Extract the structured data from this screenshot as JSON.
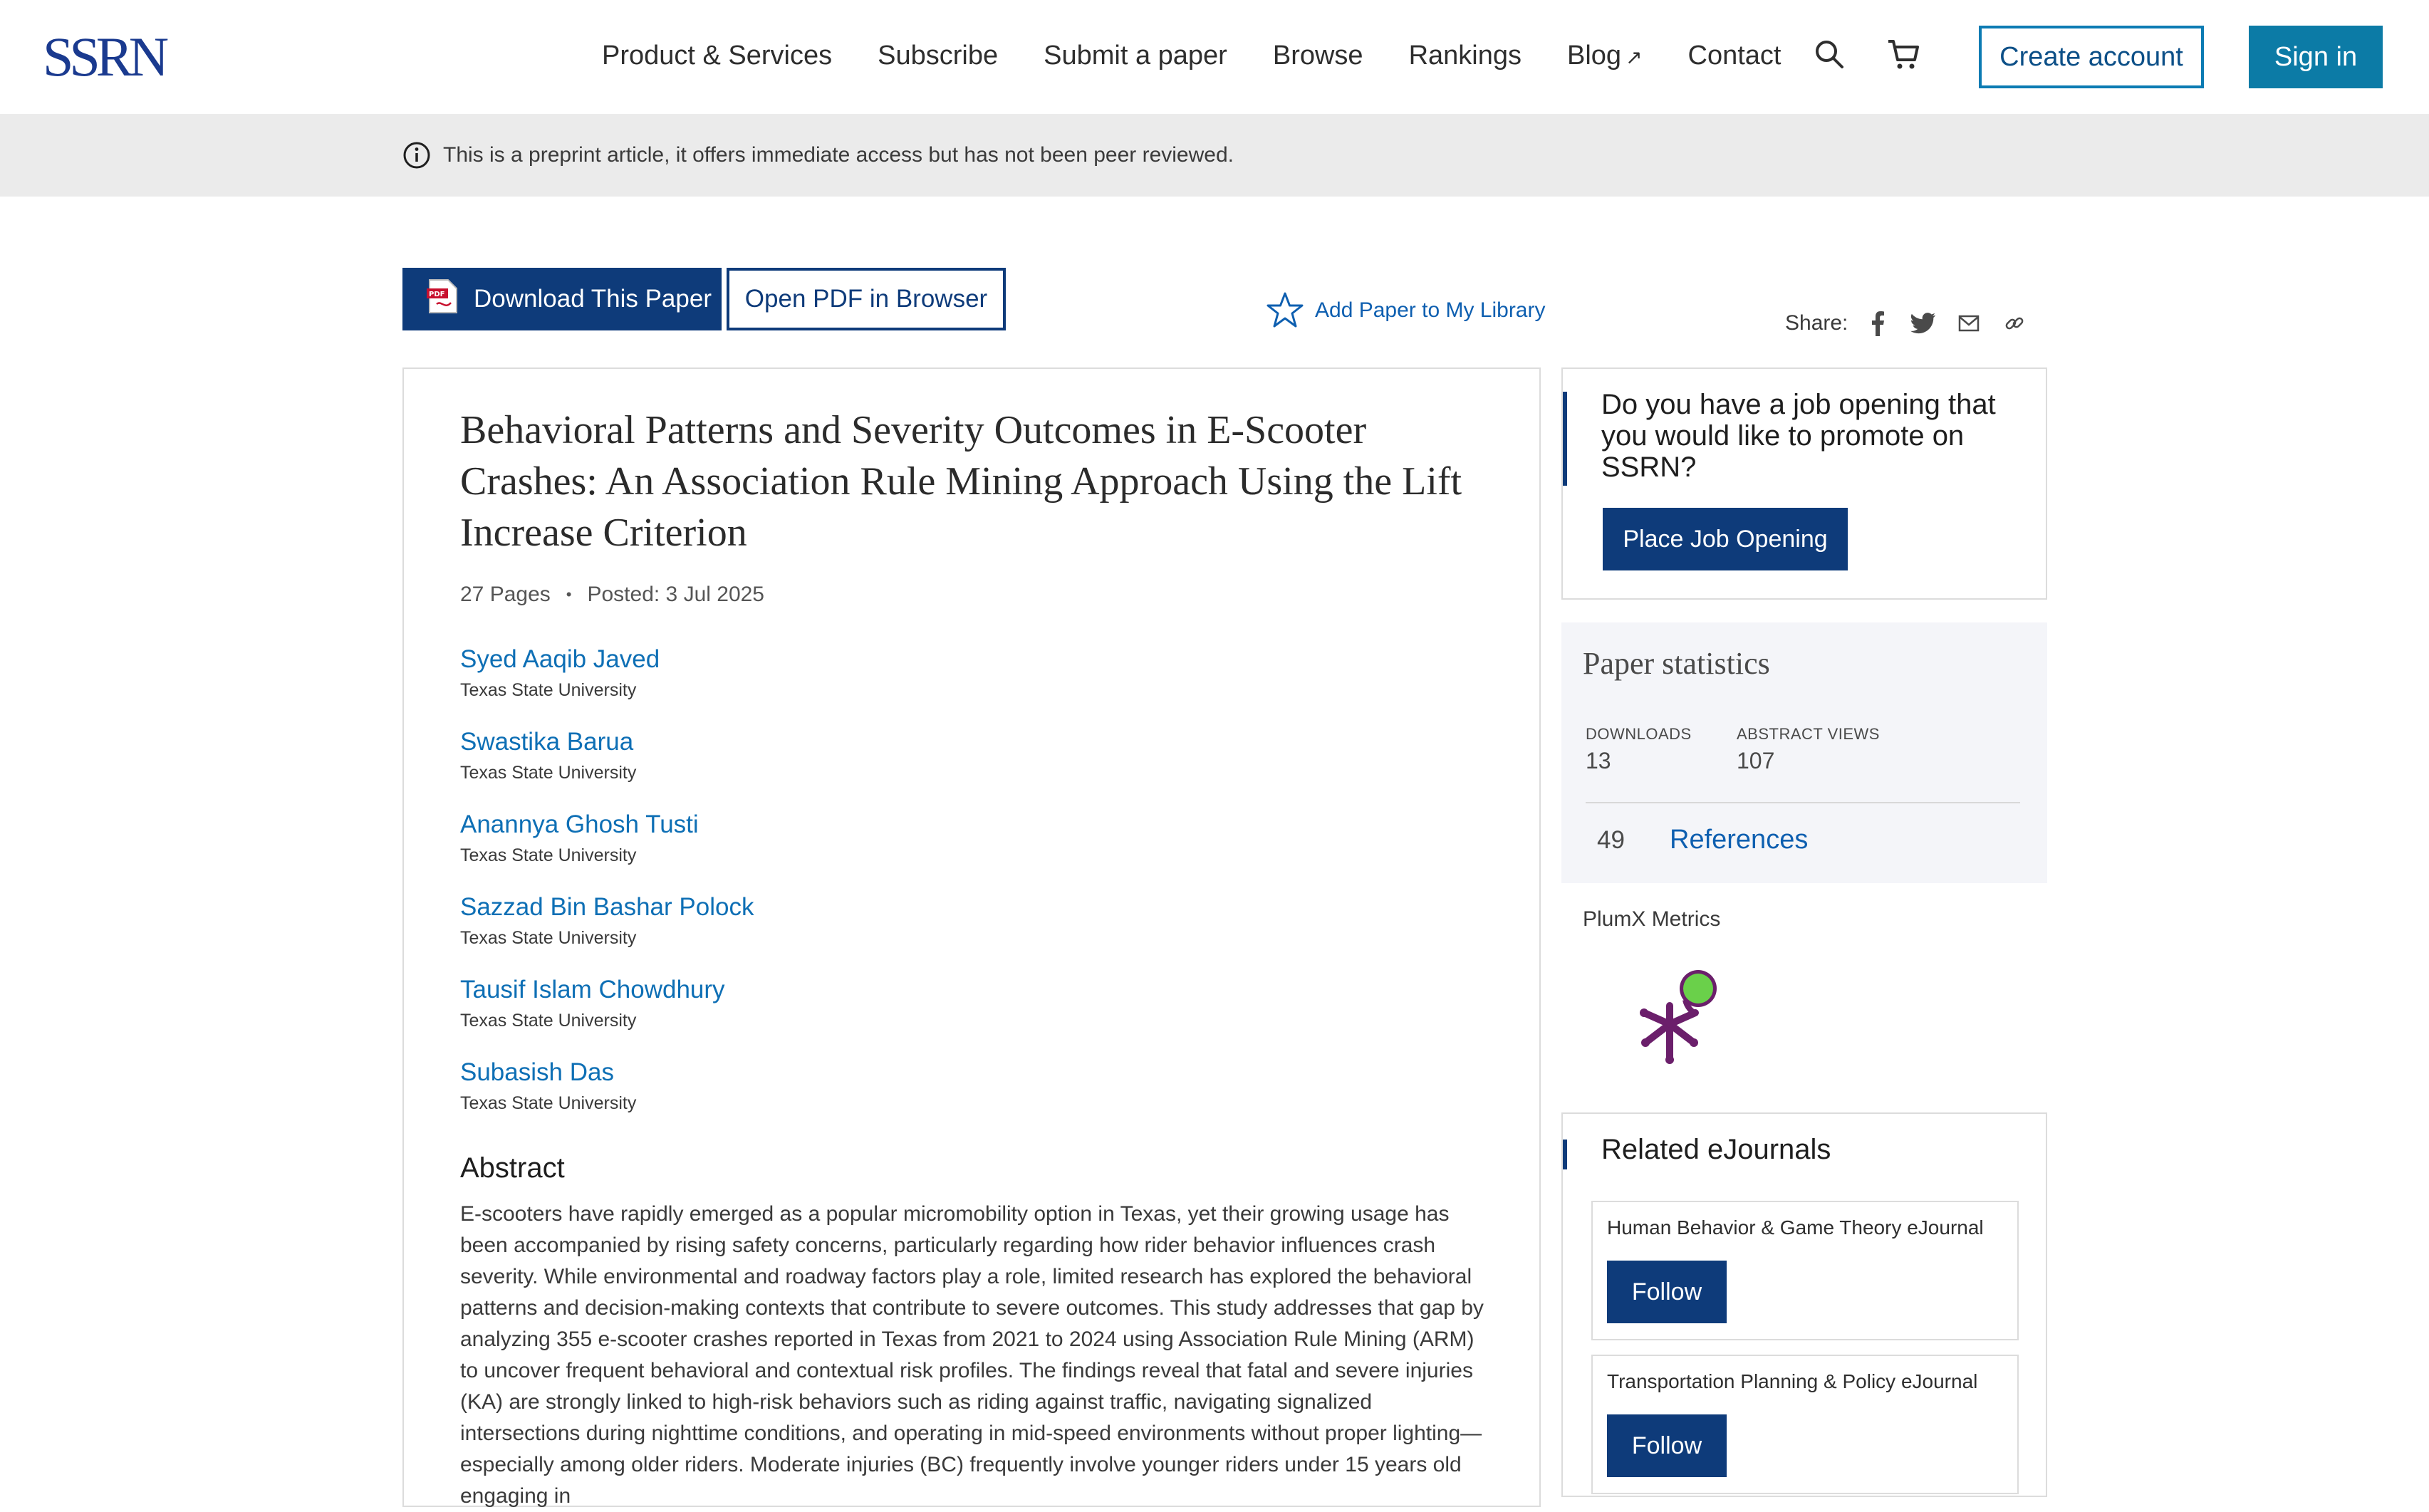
{
  "header": {
    "logo_text": "SSRN",
    "nav": [
      "Product & Services",
      "Subscribe",
      "Submit a paper",
      "Browse",
      "Rankings",
      "Blog",
      "Contact"
    ],
    "blog_ext_icon": "↗",
    "create_account": "Create account",
    "sign_in": "Sign in"
  },
  "notice": {
    "text": "This is a preprint article, it offers immediate access but has not been peer reviewed."
  },
  "actions": {
    "download": "Download This Paper",
    "open_pdf": "Open PDF in Browser",
    "add_library": "Add Paper to My Library",
    "share_label": "Share:"
  },
  "paper": {
    "title": "Behavioral Patterns and Severity Outcomes in E-Scooter Crashes: An Association Rule Mining Approach Using the Lift Increase Criterion",
    "pages": "27 Pages",
    "posted": "Posted: 3 Jul 2025",
    "authors": [
      {
        "name": "Syed Aaqib Javed",
        "affiliation": "Texas State University"
      },
      {
        "name": "Swastika Barua",
        "affiliation": "Texas State University"
      },
      {
        "name": "Anannya Ghosh Tusti",
        "affiliation": "Texas State University"
      },
      {
        "name": "Sazzad Bin Bashar Polock",
        "affiliation": "Texas State University"
      },
      {
        "name": "Tausif Islam Chowdhury",
        "affiliation": "Texas State University"
      },
      {
        "name": "Subasish Das",
        "affiliation": "Texas State University"
      }
    ],
    "abstract_heading": "Abstract",
    "abstract": "E-scooters have rapidly emerged as a popular micromobility option in Texas, yet their growing usage has been accompanied by rising safety concerns, particularly regarding how rider behavior influences crash severity. While environmental and roadway factors play a role, limited research has explored the behavioral patterns and decision-making contexts that contribute to severe outcomes. This study addresses that gap by analyzing 355 e-scooter crashes reported in Texas from 2021 to 2024 using Association Rule Mining (ARM) to uncover frequent behavioral and contextual risk profiles. The findings reveal that fatal and severe injuries (KA) are strongly linked to high-risk behaviors such as riding against traffic, navigating signalized intersections during nighttime conditions, and operating in mid-speed environments without proper lighting—especially among older riders. Moderate injuries (BC) frequently involve younger riders under 15 years old engaging in"
  },
  "sidebar": {
    "job_prompt": "Do you have a job opening that you would like to promote on SSRN?",
    "job_button": "Place Job Opening",
    "stats_title": "Paper statistics",
    "downloads_label": "DOWNLOADS",
    "downloads_value": "13",
    "views_label": "ABSTRACT VIEWS",
    "views_value": "107",
    "references_count": "49",
    "references_label": "References",
    "plumx_label": "PlumX Metrics",
    "related_title": "Related eJournals",
    "ejournals": [
      {
        "name": "Human Behavior & Game Theory eJournal",
        "follow": "Follow"
      },
      {
        "name": "Transportation Planning & Policy eJournal",
        "follow": "Follow"
      }
    ]
  },
  "colors": {
    "brand_navy": "#0e3b7a",
    "link_blue": "#0e6fb5",
    "signin_blue": "#0c7ba6",
    "plumx_purple": "#6b1f6b",
    "plumx_green": "#6ad04a"
  },
  "icons": [
    "search-icon",
    "cart-icon",
    "info-icon",
    "pdf-icon",
    "star-icon",
    "facebook-icon",
    "twitter-icon",
    "mail-icon",
    "link-icon",
    "plumx-icon"
  ]
}
